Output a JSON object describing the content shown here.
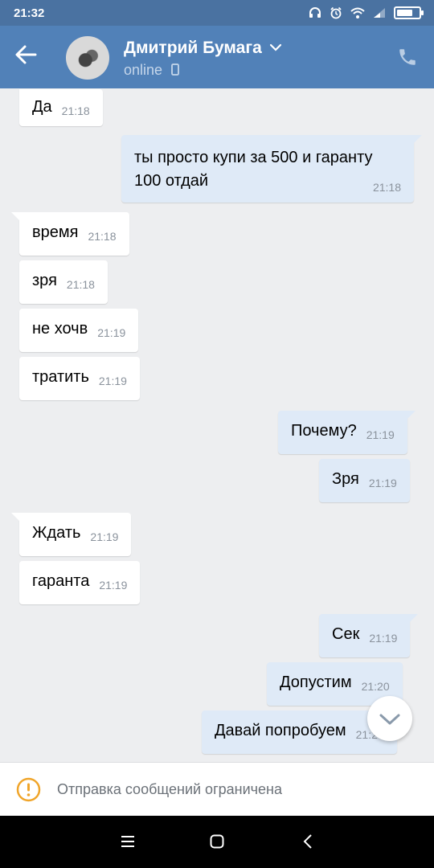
{
  "status_bar": {
    "time": "21:32",
    "battery_level": 0.85
  },
  "header": {
    "contact_name": "Дмитрий Бумага",
    "contact_status": "online",
    "accent_color": "#5181b8"
  },
  "messages": [
    {
      "dir": "in",
      "text": "Да",
      "time": "21:18"
    },
    {
      "dir": "out",
      "text_lines": [
        "ты просто купи за 500 и гаранту",
        "100 отдай"
      ],
      "time": "21:18"
    },
    {
      "dir": "in",
      "text": "время",
      "time": "21:18"
    },
    {
      "dir": "in",
      "text": "зря",
      "time": "21:18"
    },
    {
      "dir": "in",
      "text": "не хочв",
      "time": "21:19"
    },
    {
      "dir": "in",
      "text": "тратить",
      "time": "21:19"
    },
    {
      "dir": "out",
      "text": "Почему?",
      "time": "21:19"
    },
    {
      "dir": "out",
      "text": "Зря",
      "time": "21:19"
    },
    {
      "dir": "in",
      "text": "Ждать",
      "time": "21:19"
    },
    {
      "dir": "in",
      "text": "гаранта",
      "time": "21:19"
    },
    {
      "dir": "out",
      "text": "Сек",
      "time": "21:19"
    },
    {
      "dir": "out",
      "text": "Допустим",
      "time": "21:20"
    },
    {
      "dir": "out",
      "text": "Давай попробуем",
      "time": "21:20"
    }
  ],
  "restriction_notice": "Отправка сообщений ограничена",
  "icons": {
    "back": "arrow-left-icon",
    "name_dropdown": "chevron-down-icon",
    "device": "mobile-device-icon",
    "call": "phone-icon",
    "scroll_down": "chevron-down-icon",
    "warning": "exclamation-circle-icon"
  }
}
